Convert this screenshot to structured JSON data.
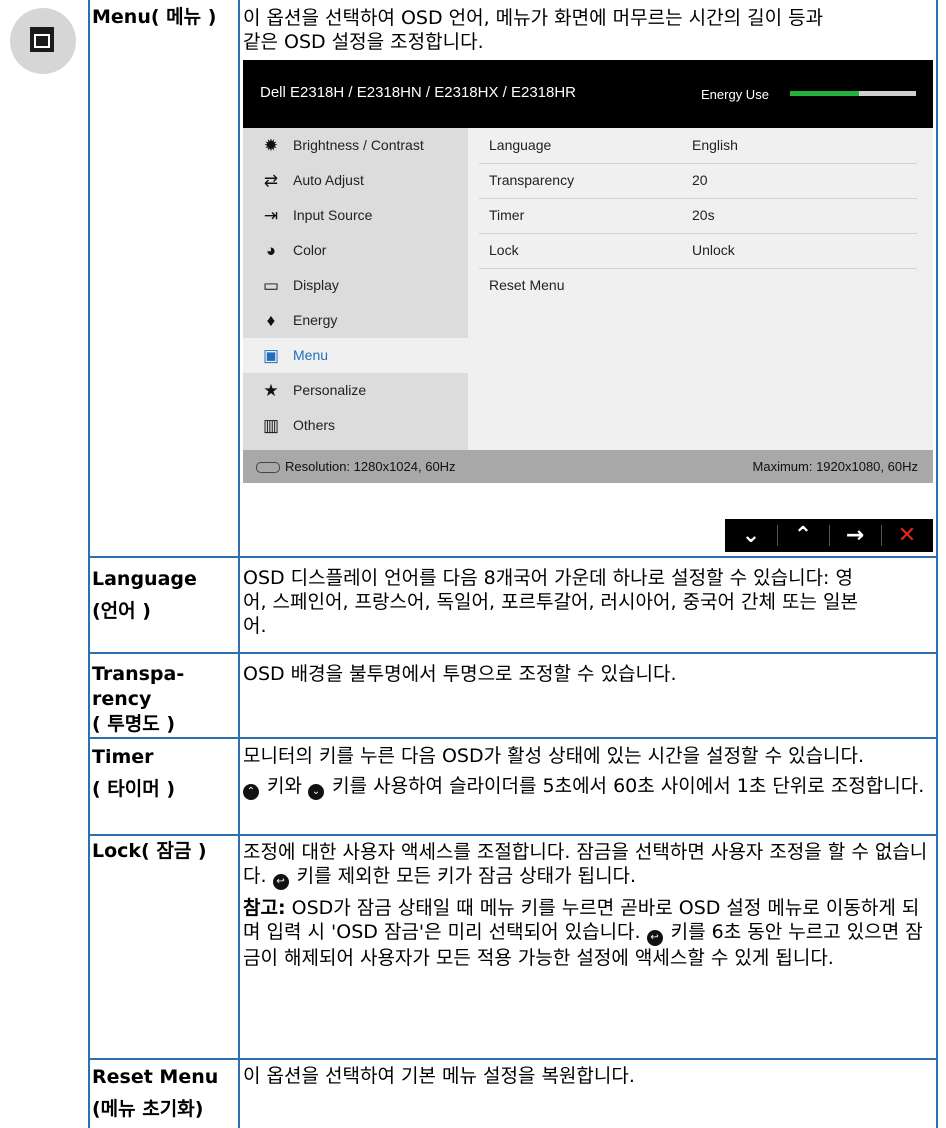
{
  "menu": {
    "label": "Menu( 메뉴 )",
    "description": "이 옵션을 선택하여 OSD 언어, 메뉴가 화면에 머무르는 시간의 길이 등과 같은 OSD 설정을 조정합니다."
  },
  "osd": {
    "model": "Dell E2318H / E2318HN / E2318HX / E2318HR",
    "energy_label": "Energy Use",
    "energy_level": 0.55,
    "sidebar": [
      {
        "label": "Brightness / Contrast",
        "icon": "brightness-icon"
      },
      {
        "label": "Auto Adjust",
        "icon": "auto-adjust-icon"
      },
      {
        "label": "Input Source",
        "icon": "input-source-icon"
      },
      {
        "label": "Color",
        "icon": "color-icon"
      },
      {
        "label": "Display",
        "icon": "display-icon"
      },
      {
        "label": "Energy",
        "icon": "energy-icon"
      },
      {
        "label": "Menu",
        "icon": "menu-icon",
        "active": true
      },
      {
        "label": "Personalize",
        "icon": "star-icon"
      },
      {
        "label": "Others",
        "icon": "others-icon"
      }
    ],
    "settings": [
      {
        "name": "Language",
        "value": "English"
      },
      {
        "name": "Transparency",
        "value": "20"
      },
      {
        "name": "Timer",
        "value": "20s"
      },
      {
        "name": "Lock",
        "value": "Unlock"
      },
      {
        "name": "Reset Menu",
        "value": ""
      }
    ],
    "resolution": "Resolution: 1280x1024, 60Hz",
    "maximum": "Maximum: 1920x1080, 60Hz",
    "nav_buttons": [
      "down-arrow-icon",
      "up-arrow-icon",
      "right-arrow-icon",
      "close-icon"
    ],
    "accent_color": "#1f6fc0",
    "energy_color": "#21b33c"
  },
  "rows": {
    "language": {
      "label_1": "Language",
      "label_2": "(언어 )",
      "text": "OSD 디스플레이 언어를 다음 8개국어 가운데 하나로 설정할 수 있습니다: 영어, 스페인어, 프랑스어, 독일어, 포르투갈어, 러시아어, 중국어 간체 또는 일본어."
    },
    "transparency": {
      "label_1": "Transpa-",
      "label_2": "rency",
      "label_3": "( 투명도 )",
      "text": "OSD 배경을 불투명에서 투명으로 조정할 수 있습니다."
    },
    "timer": {
      "label_1": "Timer",
      "label_2": "( 타이머 )",
      "text_1": "모니터의 키를 누른 다음 OSD가 활성 상태에 있는 시간을 설정할 수 있습니다.",
      "text_2": "키와",
      "text_3": "키를 사용하여 슬라이더를 5초에서 60초 사이에서 1초 단위로 조정합니다."
    },
    "lock": {
      "label": "Lock( 잠금 )",
      "text_1a": "조정에 대한 사용자 액세스를 조절합니다. 잠금을 선택하면 사용자 조정을 할 수 없습니다.",
      "text_1b": "키를 제외한 모든 키가 잠금 상태가 됩니다.",
      "note_label": "참고:",
      "note_a": "OSD가 잠금 상태일 때 메뉴 키를 누르면 곧바로 OSD 설정 메뉴로 이동하게 되며 입력 시 'OSD 잠금'은 미리 선택되어 있습니다.",
      "note_b": "키를 6초 동안 누르고 있으면 잠금이 해제되어 사용자가 모든 적용 가능한 설정에 액세스할 수 있게 됩니다."
    },
    "reset": {
      "label_1": "Reset Menu",
      "label_2": "(메뉴 초기화)",
      "text": "이 옵션을 선택하여 기본 메뉴 설정을 복원합니다."
    }
  }
}
